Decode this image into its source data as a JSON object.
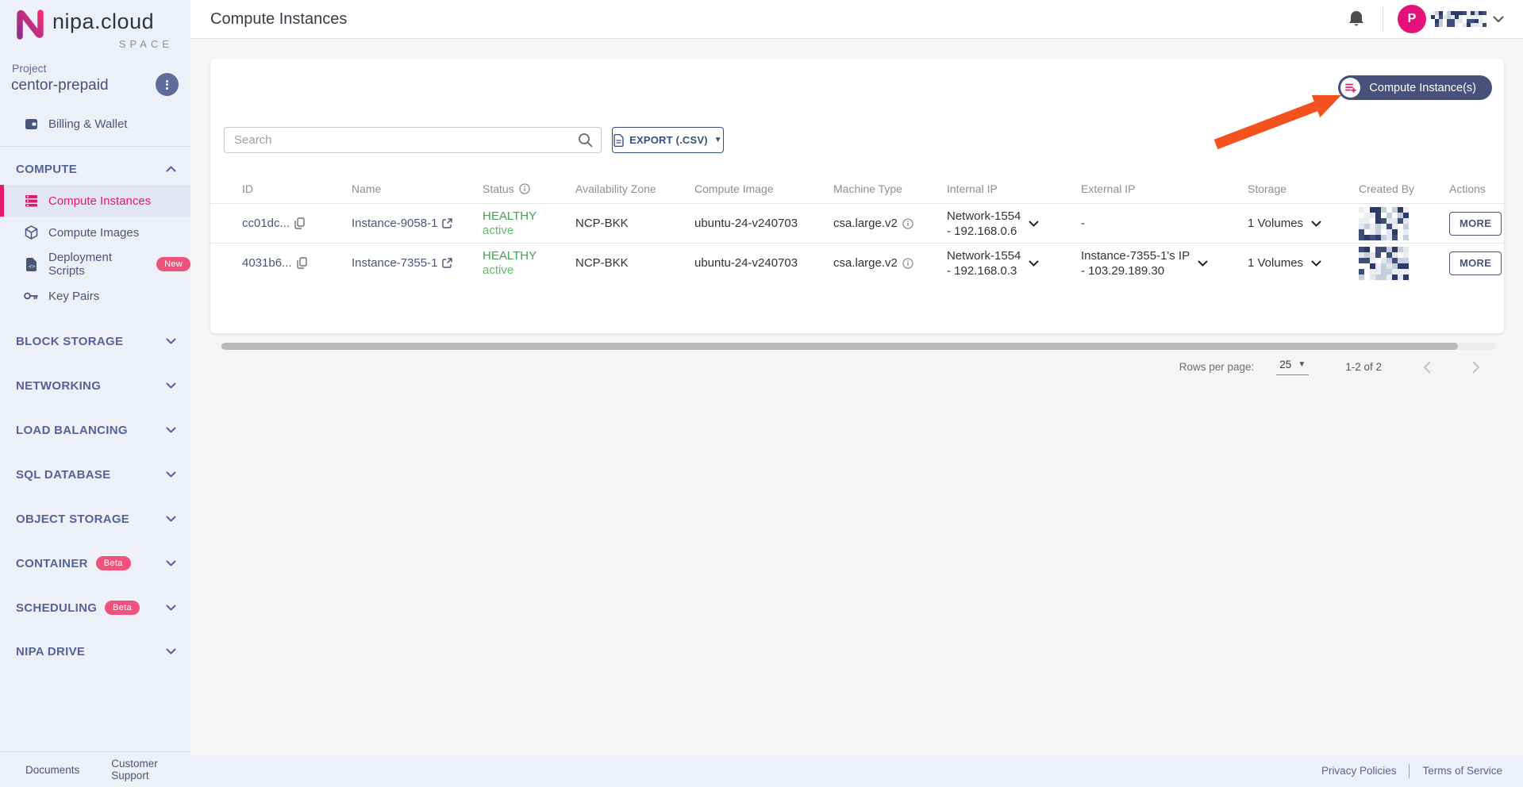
{
  "brand": {
    "name": "nipa.cloud",
    "sub": "SPACE"
  },
  "sidebar": {
    "project_label": "Project",
    "project_name": "centor-prepaid",
    "billing_label": "Billing & Wallet",
    "compute_section": "COMPUTE",
    "compute_items": [
      {
        "label": "Compute Instances"
      },
      {
        "label": "Compute Images"
      },
      {
        "label": "Deployment Scripts",
        "badge": "New"
      },
      {
        "label": "Key Pairs"
      }
    ],
    "sections": [
      {
        "label": "BLOCK STORAGE"
      },
      {
        "label": "NETWORKING"
      },
      {
        "label": "LOAD BALANCING"
      },
      {
        "label": "SQL DATABASE"
      },
      {
        "label": "OBJECT STORAGE"
      },
      {
        "label": "CONTAINER",
        "badge": "Beta"
      },
      {
        "label": "SCHEDULING",
        "badge": "Beta"
      },
      {
        "label": "NIPA DRIVE"
      }
    ],
    "footer_links": [
      {
        "label": "Documents"
      },
      {
        "label": "Customer Support"
      }
    ]
  },
  "topbar": {
    "title": "Compute Instances",
    "avatar_letter": "P"
  },
  "toolbar": {
    "create_button": "Compute Instance(s)",
    "search_placeholder": "Search",
    "export_label": "EXPORT (.CSV)"
  },
  "table": {
    "columns": [
      "ID",
      "Name",
      "Status",
      "Availability Zone",
      "Compute Image",
      "Machine Type",
      "Internal IP",
      "External IP",
      "Storage",
      "Created By",
      "Actions"
    ],
    "rows": [
      {
        "id": "cc01dc...",
        "name": "Instance-9058-1",
        "status_line1": "HEALTHY",
        "status_line2": "active",
        "zone": "NCP-BKK",
        "image": "ubuntu-24-v240703",
        "machine": "csa.large.v2",
        "internal_line1": "Network-1554",
        "internal_line2": "- 192.168.0.6",
        "external_line1": "-",
        "external_line2": "",
        "storage": "1 Volumes",
        "action": "MORE"
      },
      {
        "id": "4031b6...",
        "name": "Instance-7355-1",
        "status_line1": "HEALTHY",
        "status_line2": "active",
        "zone": "NCP-BKK",
        "image": "ubuntu-24-v240703",
        "machine": "csa.large.v2",
        "internal_line1": "Network-1554",
        "internal_line2": "- 192.168.0.3",
        "external_line1": "Instance-7355-1's IP",
        "external_line2": "- 103.29.189.30",
        "storage": "1 Volumes",
        "action": "MORE"
      }
    ]
  },
  "pagination": {
    "label": "Rows per page:",
    "value": "25",
    "range": "1-2 of 2"
  },
  "footer": {
    "links": [
      {
        "label": "Privacy Policies"
      },
      {
        "label": "Terms of Service"
      }
    ]
  },
  "colors": {
    "accent_pink": "#E5186E",
    "navy_button": "#47517B",
    "slate": "#4A5578",
    "status_green": "#3DA548",
    "arrow_orange": "#F4511E",
    "sidebar_bg": "#EEF0F7"
  }
}
